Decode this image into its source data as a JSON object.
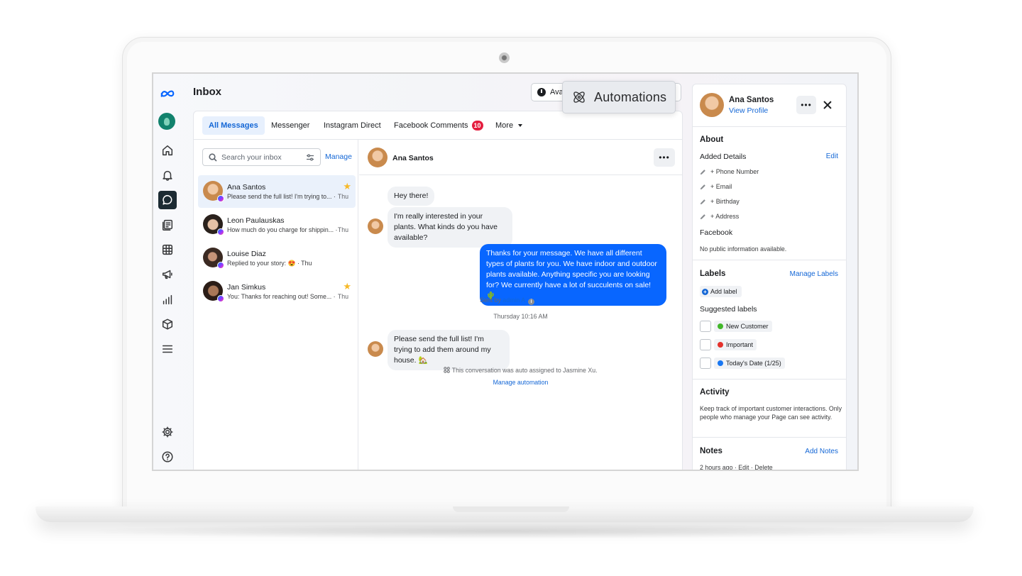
{
  "header": {
    "title": "Inbox",
    "availability_label": "Ava",
    "automations_label": "Automations"
  },
  "tabs": [
    {
      "label": "All Messages"
    },
    {
      "label": "Messenger"
    },
    {
      "label": "Instagram Direct"
    },
    {
      "label": "Facebook Comments",
      "badge": "10"
    },
    {
      "label": "More"
    }
  ],
  "search": {
    "placeholder": "Search your inbox",
    "manage_label": "Manage"
  },
  "conversations": [
    {
      "name": "Ana Santos",
      "preview": "Please send the full list! I'm trying to... ·",
      "time": "Thu",
      "starred": true
    },
    {
      "name": "Leon Paulauskas",
      "preview": "How much do you charge for shippin... ·",
      "time": "Thu",
      "starred": false
    },
    {
      "name": "Louise Diaz",
      "preview": "Replied to your story: 😍 · Thu",
      "time": "",
      "starred": false
    },
    {
      "name": "Jan Simkus",
      "preview": "You: Thanks for reaching out! Some... ·",
      "time": "Thu",
      "starred": true
    }
  ],
  "thread": {
    "contact_name": "Ana Santos",
    "messages": [
      {
        "text": "Hey there!"
      },
      {
        "text": "I'm really interested in your plants. What kinds do you have available?"
      },
      {
        "text": "Thanks for your message. We have all different types of plants for you. We have indoor and outdoor plants available. Anything specific you are looking for? We currently have a lot of succulents on sale! 🌵"
      },
      {
        "text": "Please send the full list! I'm trying to add them around my house. 🏡"
      }
    ],
    "sent_by_prefix": "Sent by",
    "sent_by_name": "admin A",
    "timestamp": "Thursday 10:16 AM",
    "auto_assigned": "This conversation was auto assigned to Jasmine Xu.",
    "manage_automation": "Manage automation"
  },
  "details": {
    "name": "Ana Santos",
    "view_profile": "View Profile",
    "about_title": "About",
    "added_details": "Added Details",
    "edit": "Edit",
    "fields": [
      "+ Phone Number",
      "+ Email",
      "+ Birthday",
      "+ Address"
    ],
    "facebook_title": "Facebook",
    "facebook_info": "No public information available.",
    "labels_title": "Labels",
    "manage_labels": "Manage Labels",
    "add_label": "Add label",
    "suggested_labels": "Suggested labels",
    "labels": [
      {
        "name": "New Customer",
        "color": "#42b72a"
      },
      {
        "name": "Important",
        "color": "#e4312b"
      },
      {
        "name": "Today's Date (1/25)",
        "color": "#1877f2"
      }
    ],
    "activity_title": "Activity",
    "activity_text": "Keep track of important customer interactions. Only people who manage your Page can see activity.",
    "notes_title": "Notes",
    "add_notes": "Add Notes",
    "notes_meta": "2 hours ago · Edit · Delete"
  },
  "colors": {
    "accent": "#0866ff",
    "link": "#1467d6",
    "badge": "#e41e3f",
    "star": "#f7b928"
  }
}
